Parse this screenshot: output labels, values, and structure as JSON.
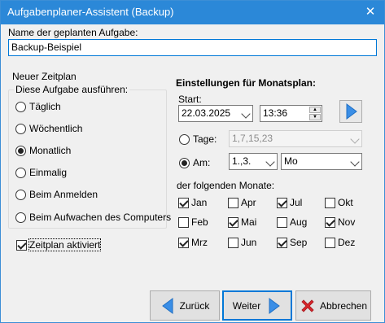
{
  "window": {
    "title": "Aufgabenplaner-Assistent (Backup)",
    "close_glyph": "✕"
  },
  "task_name": {
    "label": "Name der geplanten Aufgabe:",
    "value": "Backup-Beispiel"
  },
  "schedule": {
    "section_label": "Neuer Zeitplan",
    "group_caption": "Diese Aufgabe ausführen:",
    "options": [
      {
        "label": "Täglich",
        "checked": false
      },
      {
        "label": "Wöchentlich",
        "checked": false
      },
      {
        "label": "Monatlich",
        "checked": true
      },
      {
        "label": "Einmalig",
        "checked": false
      },
      {
        "label": "Beim Anmelden",
        "checked": false
      },
      {
        "label": "Beim Aufwachen des Computers",
        "checked": false
      }
    ],
    "enabled_label": "Zeitplan aktiviert",
    "enabled_checked": true
  },
  "monthly": {
    "heading": "Einstellungen für Monatsplan:",
    "start_label": "Start:",
    "start_date": "22.03.2025",
    "start_time": "13:36",
    "days_label": "Tage:",
    "days_value": "1,7,15,23",
    "days_checked": false,
    "on_label": "Am:",
    "on_checked": true,
    "ordinal": "1.,3.",
    "weekday": "Mo",
    "months_label": "der folgenden Monate:",
    "months": [
      {
        "name": "Jan",
        "checked": true
      },
      {
        "name": "Apr",
        "checked": false
      },
      {
        "name": "Jul",
        "checked": true
      },
      {
        "name": "Okt",
        "checked": false
      },
      {
        "name": "Feb",
        "checked": false
      },
      {
        "name": "Mai",
        "checked": true
      },
      {
        "name": "Aug",
        "checked": false
      },
      {
        "name": "Nov",
        "checked": true
      },
      {
        "name": "Mrz",
        "checked": true
      },
      {
        "name": "Jun",
        "checked": false
      },
      {
        "name": "Sep",
        "checked": true
      },
      {
        "name": "Dez",
        "checked": false
      }
    ]
  },
  "buttons": {
    "back": "Zurück",
    "next": "Weiter",
    "cancel": "Abbrechen"
  },
  "colors": {
    "title_bar": "#2b88d8",
    "accent": "#0078d7",
    "arrow_blue": "#3a8ee6",
    "cancel_red": "#d9262c"
  }
}
